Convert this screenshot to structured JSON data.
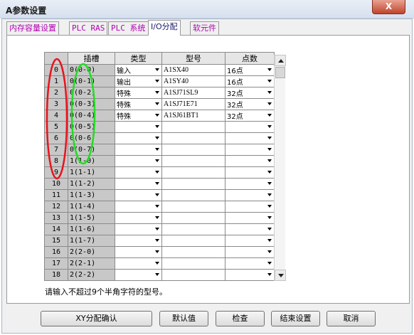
{
  "window": {
    "title": "A参数设置",
    "close_glyph": "X"
  },
  "tabs": [
    {
      "label": "内存容量设置"
    },
    {
      "label": "PLC RAS"
    },
    {
      "label": "PLC 系统"
    },
    {
      "label": "I/O分配"
    },
    {
      "label": "软元件"
    }
  ],
  "table": {
    "headers": {
      "slot": "插槽",
      "type": "类型",
      "model": "型号",
      "points": "点数"
    },
    "rows": [
      {
        "num": "0",
        "slot": "0(0-0)",
        "type": "输入",
        "model": "A1SX40",
        "points": "16点"
      },
      {
        "num": "1",
        "slot": "0(0-1)",
        "type": "输出",
        "model": "A1SY40",
        "points": "16点"
      },
      {
        "num": "2",
        "slot": "0(0-2)",
        "type": "特殊",
        "model": "A1SJ71SL9",
        "points": "32点"
      },
      {
        "num": "3",
        "slot": "0(0-3)",
        "type": "特殊",
        "model": "A1SJ71E71",
        "points": "32点"
      },
      {
        "num": "4",
        "slot": "0(0-4)",
        "type": "特殊",
        "model": "A1SJ61BT1",
        "points": "32点"
      },
      {
        "num": "5",
        "slot": "0(0-5)",
        "type": "",
        "model": "",
        "points": ""
      },
      {
        "num": "6",
        "slot": "0(0-6)",
        "type": "",
        "model": "",
        "points": ""
      },
      {
        "num": "7",
        "slot": "0(0-7)",
        "type": "",
        "model": "",
        "points": ""
      },
      {
        "num": "8",
        "slot": "1(1-0)",
        "type": "",
        "model": "",
        "points": ""
      },
      {
        "num": "9",
        "slot": "1(1-1)",
        "type": "",
        "model": "",
        "points": ""
      },
      {
        "num": "10",
        "slot": "1(1-2)",
        "type": "",
        "model": "",
        "points": ""
      },
      {
        "num": "11",
        "slot": "1(1-3)",
        "type": "",
        "model": "",
        "points": ""
      },
      {
        "num": "12",
        "slot": "1(1-4)",
        "type": "",
        "model": "",
        "points": ""
      },
      {
        "num": "13",
        "slot": "1(1-5)",
        "type": "",
        "model": "",
        "points": ""
      },
      {
        "num": "14",
        "slot": "1(1-6)",
        "type": "",
        "model": "",
        "points": ""
      },
      {
        "num": "15",
        "slot": "1(1-7)",
        "type": "",
        "model": "",
        "points": ""
      },
      {
        "num": "16",
        "slot": "2(2-0)",
        "type": "",
        "model": "",
        "points": ""
      },
      {
        "num": "17",
        "slot": "2(2-1)",
        "type": "",
        "model": "",
        "points": ""
      },
      {
        "num": "18",
        "slot": "2(2-2)",
        "type": "",
        "model": "",
        "points": ""
      }
    ]
  },
  "hint": "请输入不超过9个半角字符的型号。",
  "buttons": {
    "xy_assign": "XY分配确认",
    "default": "默认值",
    "check": "检查",
    "end": "结束设置",
    "cancel": "取消"
  },
  "annotations": {
    "left_ellipse_color": "#e8141c",
    "right_ellipse_color": "#22dd22"
  }
}
